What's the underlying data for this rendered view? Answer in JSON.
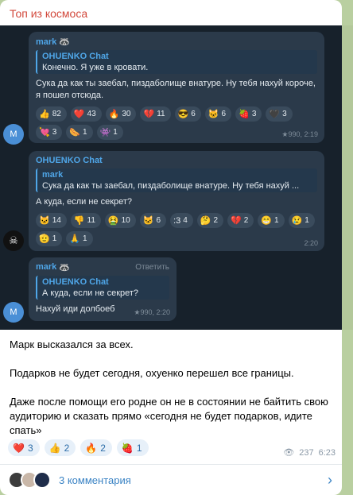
{
  "channel_title": "Топ из космоса",
  "screenshot": {
    "msg1": {
      "sender": "mark",
      "sender_icon": "raccoon-emoji",
      "quote_name": "OHUENKO Chat",
      "quote_text": "Конечно. Я уже в кровати.",
      "text": "Сука да как ты заебал, пиздаболище внатуре. Ну тебя нахуй короче, я пошел отсюда.",
      "reactions": [
        {
          "e": "👍",
          "n": "82"
        },
        {
          "e": "❤️",
          "n": "43"
        },
        {
          "e": "🔥",
          "n": "30"
        },
        {
          "e": "💔",
          "n": "11"
        },
        {
          "e": "😎",
          "n": "6"
        },
        {
          "e": "🐱",
          "n": "6"
        },
        {
          "e": "🍓",
          "n": "3"
        },
        {
          "e": "🖤",
          "n": "3"
        },
        {
          "e": "💘",
          "n": "3"
        },
        {
          "e": "🌭",
          "n": "1"
        },
        {
          "e": "👾",
          "n": "1"
        }
      ],
      "meta": "★990, 2:19",
      "avatar": "M"
    },
    "msg2": {
      "sender": "OHUENKO Chat",
      "quote_name": "mark",
      "quote_text": "Сука да как ты заебал, пиздаболище внатуре. Ну тебя нахуй ...",
      "text": "А куда, если не секрет?",
      "reactions": [
        {
          "e": "🐱",
          "n": "14"
        },
        {
          "e": "👎",
          "n": "11"
        },
        {
          "e": "🤮",
          "n": "10"
        },
        {
          "e": "🐱",
          "n": "6"
        },
        {
          "e": ":3",
          "n": "4"
        },
        {
          "e": "🤔",
          "n": "2"
        },
        {
          "e": "💔",
          "n": "2"
        },
        {
          "e": "😁",
          "n": "1"
        },
        {
          "e": "😢",
          "n": "1"
        },
        {
          "e": "🫡",
          "n": "1"
        },
        {
          "e": "🙏",
          "n": "1"
        }
      ],
      "meta": "2:20",
      "avatar": "☠"
    },
    "msg3": {
      "sender": "mark",
      "reply_label": "Ответить",
      "quote_name": "OHUENKO Chat",
      "quote_text": "А куда, если не секрет?",
      "text": "Нахуй иди долбоеб",
      "meta": "★990, 2:20",
      "avatar": "M"
    }
  },
  "caption": {
    "p1": "Марк высказался за всех.",
    "p2": "Подарков не будет сегодня, охуенко перешел все границы.",
    "p3": "Даже после помощи его родне он не в состоянии не байтить свою аудиторию и сказать прямо «сегодня не будет подарков, идите спать»"
  },
  "post_reactions": [
    {
      "e": "❤️",
      "n": "3"
    },
    {
      "e": "👍",
      "n": "2"
    },
    {
      "e": "🔥",
      "n": "2"
    },
    {
      "e": "🍓",
      "n": "1"
    }
  ],
  "views": "237",
  "time": "6:23",
  "comments_label": "3 комментария",
  "colors": {
    "channel_title": "#d2483b",
    "accent": "#3a83c4",
    "chat_bg": "#17212b"
  }
}
